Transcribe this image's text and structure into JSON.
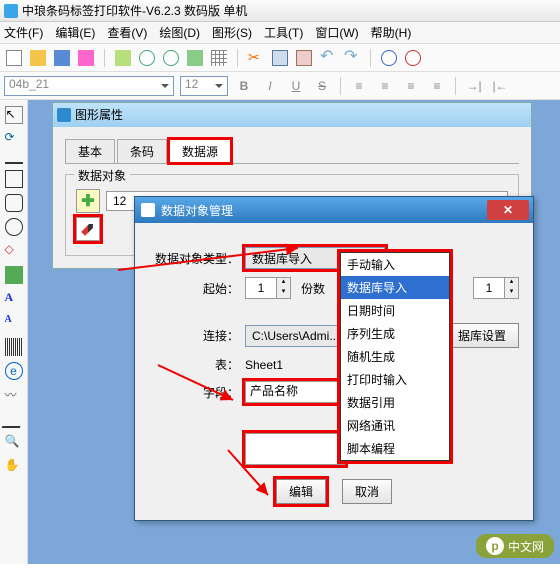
{
  "app": {
    "title": "中琅条码标签打印软件-V6.2.3 数码版 单机"
  },
  "menu": {
    "file": "文件(F)",
    "edit": "编辑(E)",
    "view": "查看(V)",
    "draw": "绘图(D)",
    "shape": "图形(S)",
    "tool": "工具(T)",
    "window": "窗口(W)",
    "help": "帮助(H)"
  },
  "format": {
    "fontname": "04b_21",
    "fontsize": "12"
  },
  "panel": {
    "title": "图形属性",
    "tabs": {
      "basic": "基本",
      "barcode": "条码",
      "datasource": "数据源"
    },
    "fieldset": "数据对象",
    "value": "12"
  },
  "dialog": {
    "title": "数据对象管理",
    "type_label": "数据对象类型：",
    "type_value": "数据库导入",
    "start_label": "起始：",
    "start_value": "1",
    "copies_label": "份数",
    "copies_value": "1",
    "conn_label": "连接：",
    "conn_value": "C:\\Users\\Admi...",
    "sheet_label": "表：",
    "sheet_value": "Sheet1",
    "field_label": "字段：",
    "field_value": "产品名称",
    "dbset_btn": "据库设置",
    "edit_btn": "编辑",
    "cancel_btn": "取消",
    "options": {
      "manual": "手动输入",
      "db": "数据库导入",
      "date": "日期时间",
      "seq": "序列生成",
      "rand": "随机生成",
      "print": "打印时输入",
      "ref": "数据引用",
      "net": "网络通讯",
      "script": "脚本编程"
    }
  },
  "watermark": "中文网"
}
